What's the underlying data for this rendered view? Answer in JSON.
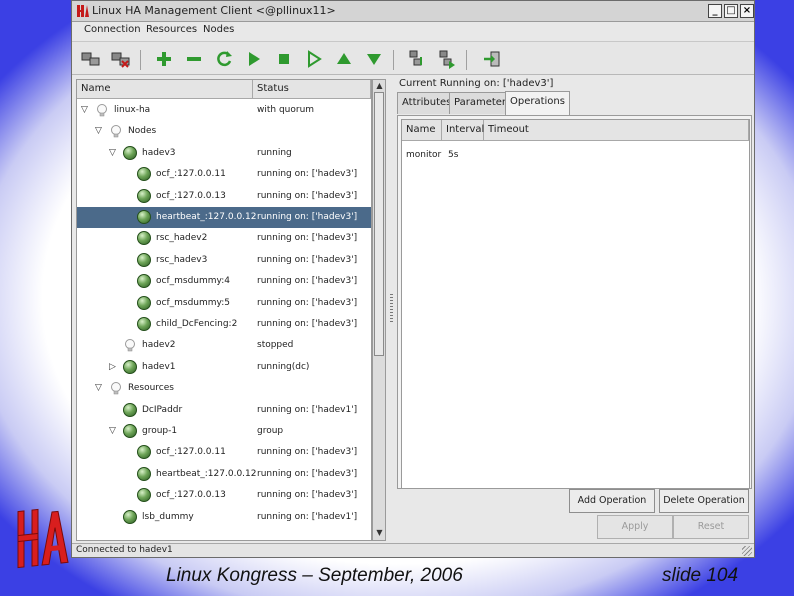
{
  "window": {
    "title": "Linux HA Management Client <@pllinux11>",
    "minimize_glyph": "_",
    "maximize_glyph": "□",
    "close_glyph": "×"
  },
  "menu": [
    "Connection",
    "Resources",
    "Nodes"
  ],
  "toolbar": {
    "icons": [
      "connect-icon",
      "disconnect-icon",
      "add-icon",
      "remove-icon",
      "refresh-icon",
      "start-icon",
      "stop-icon",
      "default-icon",
      "move-up-icon",
      "move-down-icon",
      "standby-icon",
      "active-icon",
      "exit-icon"
    ],
    "colors": {
      "green": "#2f9a2f",
      "dark": "#3a3a3a"
    }
  },
  "tree": {
    "headers": {
      "name": "Name",
      "status": "Status"
    },
    "rows": [
      {
        "name": "linux-ha",
        "status": "with quorum",
        "icon": "bulb",
        "expander": "down"
      },
      {
        "name": "Nodes",
        "status": "",
        "icon": "bulb",
        "expander": "down"
      },
      {
        "name": "hadev3",
        "status": "running",
        "icon": "ball",
        "expander": "down"
      },
      {
        "name": "ocf_:127.0.0.11",
        "status": "running on: ['hadev3']",
        "icon": "ball",
        "expander": ""
      },
      {
        "name": "ocf_:127.0.0.13",
        "status": "running on: ['hadev3']",
        "icon": "ball",
        "expander": ""
      },
      {
        "name": "heartbeat_:127.0.0.12",
        "status": "running on: ['hadev3']",
        "icon": "ball",
        "expander": "",
        "selected": true
      },
      {
        "name": "rsc_hadev2",
        "status": "running on: ['hadev3']",
        "icon": "ball",
        "expander": ""
      },
      {
        "name": "rsc_hadev3",
        "status": "running on: ['hadev3']",
        "icon": "ball",
        "expander": ""
      },
      {
        "name": "ocf_msdummy:4",
        "status": "running on: ['hadev3']",
        "icon": "ball",
        "expander": ""
      },
      {
        "name": "ocf_msdummy:5",
        "status": "running on: ['hadev3']",
        "icon": "ball",
        "expander": ""
      },
      {
        "name": "child_DcFencing:2",
        "status": "running on: ['hadev3']",
        "icon": "ball",
        "expander": ""
      },
      {
        "name": "hadev2",
        "status": "stopped",
        "icon": "bulb",
        "expander": ""
      },
      {
        "name": "hadev1",
        "status": "running(dc)",
        "icon": "ball",
        "expander": "right"
      },
      {
        "name": "Resources",
        "status": "",
        "icon": "bulb",
        "expander": "down"
      },
      {
        "name": "DcIPaddr",
        "status": "running on: ['hadev1']",
        "icon": "ball",
        "expander": ""
      },
      {
        "name": "group-1",
        "status": "group",
        "icon": "ball",
        "expander": "down"
      },
      {
        "name": "ocf_:127.0.0.11",
        "status": "running on: ['hadev3']",
        "icon": "ball",
        "expander": ""
      },
      {
        "name": "heartbeat_:127.0.0.12",
        "status": "running on: ['hadev3']",
        "icon": "ball",
        "expander": ""
      },
      {
        "name": "ocf_:127.0.0.13",
        "status": "running on: ['hadev3']",
        "icon": "ball",
        "expander": ""
      },
      {
        "name": "lsb_dummy",
        "status": "running on: ['hadev1']",
        "icon": "ball",
        "expander": ""
      }
    ]
  },
  "details": {
    "current": "Current Running on: ['hadev3']",
    "tabs": [
      "Attributes",
      "Parameters",
      "Operations"
    ],
    "active_tab": "Operations",
    "ops_headers": [
      "Name",
      "Interval",
      "Timeout"
    ],
    "ops_rows": [
      {
        "name": "monitor",
        "interval": "5s",
        "timeout": ""
      }
    ],
    "add_operation": "Add Operation",
    "delete_operation": "Delete Operation",
    "apply": "Apply",
    "reset": "Reset"
  },
  "status_bar": "Connected to hadev1",
  "slide": {
    "logo_text": "HA",
    "footer_left": "Linux Kongress – September, 2006",
    "footer_right": "slide 104",
    "logo_color": "#d81e1e"
  }
}
